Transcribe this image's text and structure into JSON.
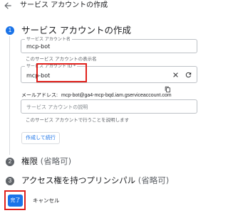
{
  "header": {
    "title": "サービス アカウントの作成"
  },
  "steps": [
    {
      "number": "1",
      "title": "サービス アカウントの作成",
      "optional": ""
    },
    {
      "number": "2",
      "title": "権限",
      "optional": "(省略可)"
    },
    {
      "number": "3",
      "title": "アクセス権を持つプリンシパル",
      "optional": "(省略可)"
    }
  ],
  "form": {
    "name_field": {
      "label": "サービス アカウント名",
      "value": "mcp-bot",
      "hint": "このサービス アカウントの表示名"
    },
    "id_field": {
      "label": "サービス アカウント ID *",
      "value": "mcp-bot"
    },
    "email": {
      "label": "メールアドレス:",
      "value": "mcp-bot@ga4-mcp-bqd.iam.gserviceaccount.com"
    },
    "description_field": {
      "placeholder": "サービス アカウントの説明",
      "hint": "このサービス アカウントで行うことを説明します"
    },
    "create_button": "作成して続行"
  },
  "footer": {
    "done_button": "完了",
    "cancel_button": "キャンセル"
  },
  "icons": {
    "back": "arrow-back-icon",
    "clear": "close-icon",
    "refresh": "refresh-icon",
    "copy": "copy-icon"
  },
  "colors": {
    "accent": "#1a73e8",
    "highlight": "#e0201b",
    "inactive_step": "#5f6368"
  }
}
